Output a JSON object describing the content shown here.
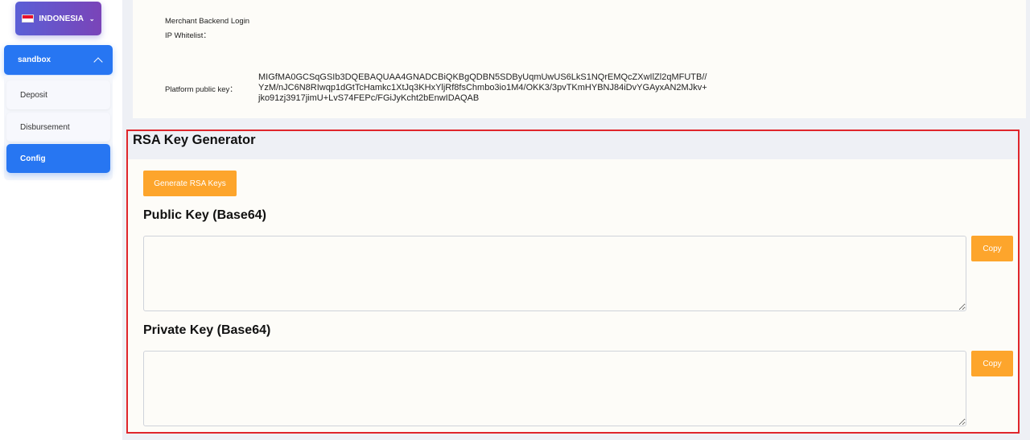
{
  "sidebar": {
    "country": {
      "label": "INDONESIA",
      "flag_icon": "indonesia-flag-icon",
      "chevron_icon": "chevron-down-icon"
    },
    "environment": {
      "label": "sandbox",
      "chevron_icon": "chevron-up-icon",
      "expanded": true
    },
    "items": [
      {
        "label": "Deposit",
        "active": false
      },
      {
        "label": "Disbursement",
        "active": false
      },
      {
        "label": "Config",
        "active": true
      }
    ]
  },
  "config": {
    "merchant_login_label": "Merchant Backend Login",
    "ip_whitelist_label": "IP Whitelist：",
    "platform_public_key_label": "Platform public key：",
    "platform_public_key_value": "MIGfMA0GCSqGSIb3DQEBAQUAA4GNADCBiQKBgQDBN5SDByUqmUwUS6LkS1NQrEMQcZXwIlZl2qMFUTB//YzM/nJC6N8RIwqp1dGtTcHamkc1XtJq3KHxYljRf8fsChmbo3io1M4/OKK3/3pvTKmHYBNJ84iDvYGAyxAN2MJkv+jko91zj3917jimU+LvS74FEPc/FGiJyKcht2bEnwIDAQAB"
  },
  "rsa": {
    "title": "RSA Key Generator",
    "generate_label": "Generate RSA Keys",
    "public_title": "Public Key (Base64)",
    "public_value": "",
    "private_title": "Private Key (Base64)",
    "private_value": "",
    "copy_label": "Copy"
  },
  "colors": {
    "accent_blue": "#2776f2",
    "accent_orange": "#fda52c",
    "highlight_red": "#e0262b",
    "country_gradient": [
      "#5b5fd6",
      "#7a44b8"
    ]
  }
}
